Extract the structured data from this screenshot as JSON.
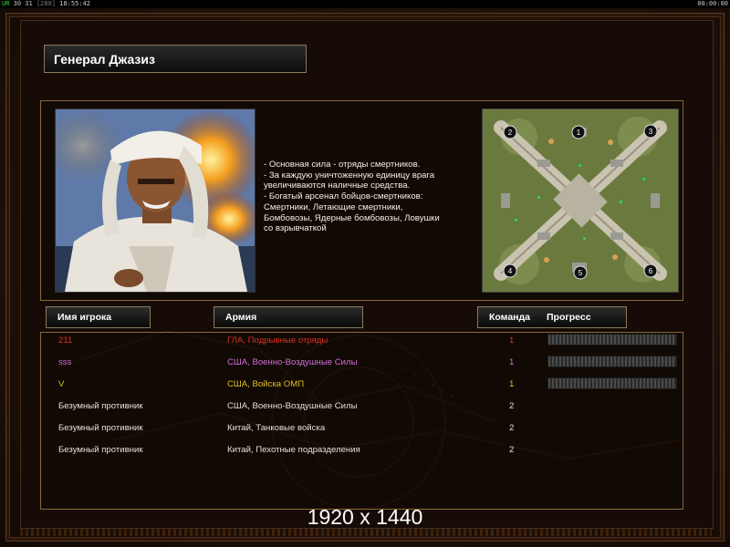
{
  "topbar": {
    "left_ur": "UR",
    "left_nums": "30 31",
    "left_dim": "[288]",
    "left_time": "18:55:42",
    "right_time": "00:00:00"
  },
  "general": {
    "title": "Генерал Джазиз",
    "description": "- Основная сила - отряды смертников.\n - За каждую уничтоженную единицу врага\n   увеличиваются наличные средства.\n - Богатый арсенал бойцов-смертников:\n   Смертники, Летающие смертники,\n   Бомбовозы, Ядерные бомбовозы, Ловушки\n   со взрывчаткой"
  },
  "minimap": {
    "slots": [
      "1",
      "2",
      "3",
      "4",
      "5",
      "6"
    ]
  },
  "headers": {
    "player": "Имя игрока",
    "army": "Армия",
    "team": "Команда",
    "progress": "Прогресс"
  },
  "players": [
    {
      "name": "211",
      "army": "ГЛА, Подрывные отряды",
      "team": "1",
      "color": "#e03020"
    },
    {
      "name": "sss",
      "army": "США, Военно-Воздушные Силы",
      "team": "1",
      "color": "#d070d8"
    },
    {
      "name": "V",
      "army": "США, Войска ОМП",
      "team": "1",
      "color": "#e0c020"
    },
    {
      "name": "Безумный противник",
      "army": "США, Военно-Воздушные Силы",
      "team": "2",
      "color": "#e6e0d6"
    },
    {
      "name": "Безумный противник",
      "army": "Китай, Танковые войска",
      "team": "2",
      "color": "#e6e0d6"
    },
    {
      "name": "Безумный противник",
      "army": "Китай, Пехотные подразделения",
      "team": "2",
      "color": "#e6e0d6"
    }
  ],
  "resolution_label": "1920 x 1440"
}
